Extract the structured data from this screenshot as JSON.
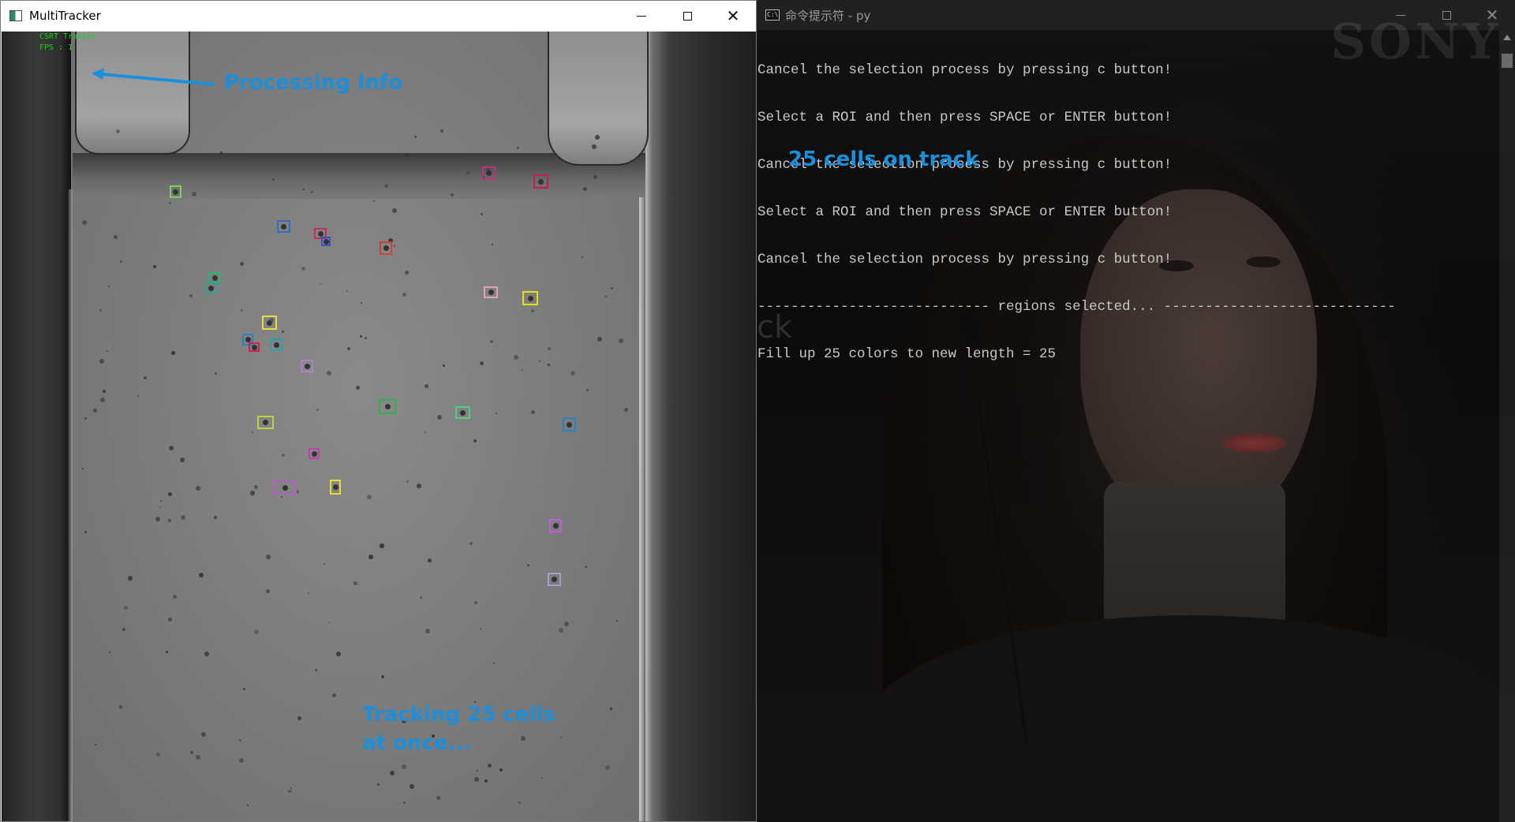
{
  "left_window": {
    "title": "MultiTracker",
    "processing_info": [
      "CSRT Tracker",
      "FPS : 1"
    ],
    "annotations": {
      "processing": "Processing Info",
      "tracking_line1": "Tracking 25 cells",
      "tracking_line2": "at once..."
    }
  },
  "right_window": {
    "title": "命令提示符 - py",
    "watermark": "SONY",
    "ghost_text": "ck",
    "console_lines": [
      "Cancel the selection process by pressing c button!",
      "Select a ROI and then press SPACE or ENTER button!",
      "Cancel the selection process by pressing c button!",
      "Select a ROI and then press SPACE or ENTER button!",
      "Cancel the selection process by pressing c button!",
      "---------------------------- regions selected... ----------------------------",
      "Fill up 25 colors to new length = 25"
    ],
    "annotation": "25 cells on track"
  },
  "colors": {
    "annotation_blue": "#1a8fdc",
    "tracker_text_green": "#18d418",
    "bbox_colors": [
      "#7fd05a",
      "#c0307a",
      "#c02050",
      "#3070c0",
      "#c03060",
      "#3a4fc8",
      "#d04040",
      "#30b070",
      "#30a090",
      "#e0a0c0",
      "#e0e020",
      "#e0e040",
      "#3080c0",
      "#30a0a0",
      "#d02050",
      "#b080d0",
      "#30b050",
      "#50d080",
      "#c0d040",
      "#3080c0",
      "#c040b0",
      "#b060c0",
      "#e0e030",
      "#c060d0",
      "#a0a0d0"
    ]
  }
}
